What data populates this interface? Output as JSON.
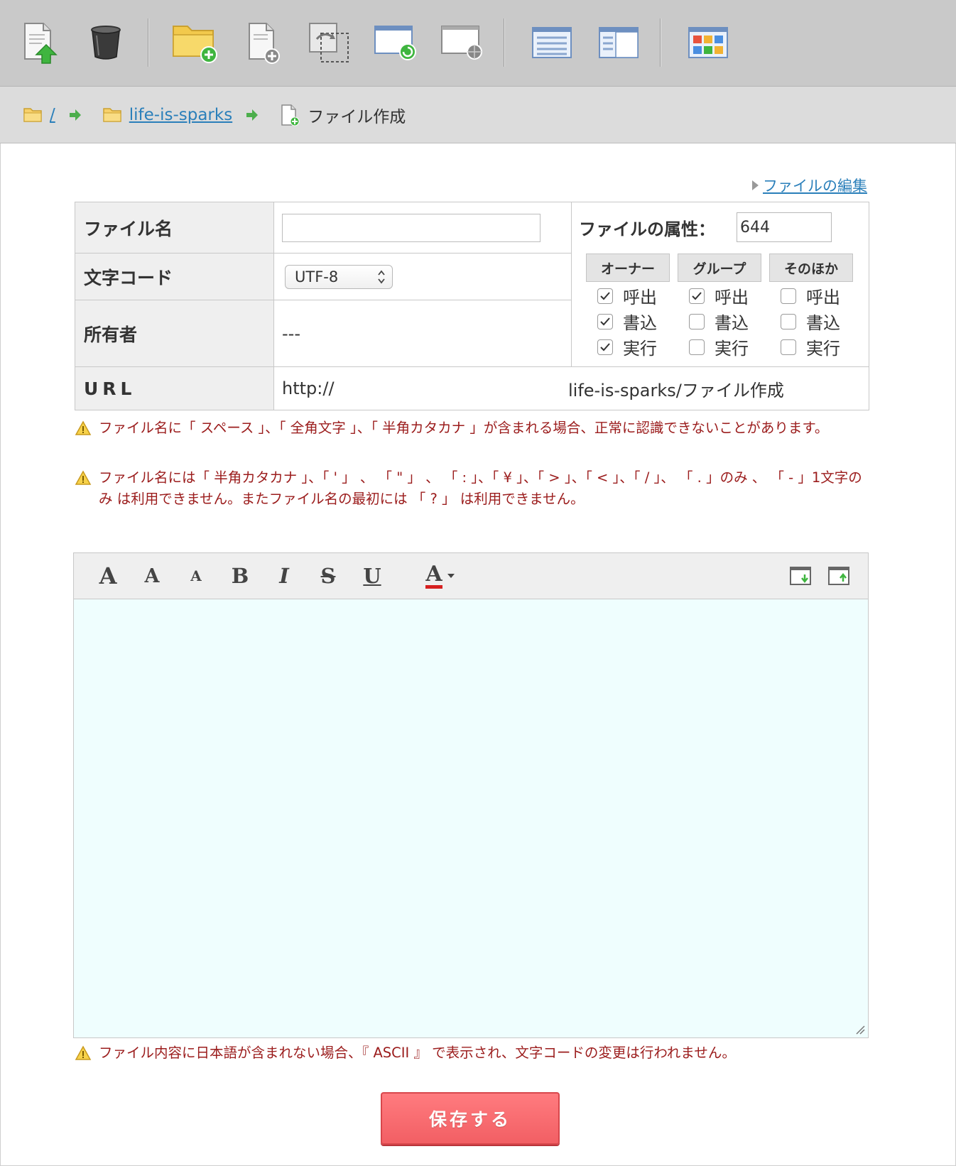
{
  "toolbar": {
    "buttons": [
      {
        "name": "upload-icon"
      },
      {
        "name": "trash-icon"
      },
      {
        "name": "new-folder-icon"
      },
      {
        "name": "new-file-icon"
      },
      {
        "name": "copy-icon"
      },
      {
        "name": "refresh-window-icon"
      },
      {
        "name": "web-window-icon"
      },
      {
        "name": "list-view-icon"
      },
      {
        "name": "split-view-icon"
      },
      {
        "name": "tile-view-icon"
      }
    ]
  },
  "breadcrumb": {
    "root": "/",
    "folder": "life-is-sparks",
    "current": "ファイル作成"
  },
  "edit_link": "ファイルの編集",
  "form": {
    "filename_label": "ファイル名",
    "filename_value": "",
    "charset_label": "文字コード",
    "charset_value": "UTF-8",
    "owner_label": "所有者",
    "owner_value": "---",
    "url_label": "URL",
    "url_value": "http://",
    "url_path": "life-is-sparks/ファイル作成",
    "attr_label": "ファイルの属性：",
    "attr_value": "644"
  },
  "permissions": {
    "headers": [
      "オーナー",
      "グループ",
      "そのほか"
    ],
    "rows": [
      "呼出",
      "書込",
      "実行"
    ],
    "checked": [
      [
        true,
        true,
        false
      ],
      [
        true,
        false,
        false
      ],
      [
        true,
        false,
        false
      ]
    ]
  },
  "warnings": {
    "w1": "ファイル名に「 スペース 」、「 全角文字 」、「 半角カタカナ 」が含まれる場合、正常に認識できないことがあります。",
    "w2": "ファイル名には「 半角カタカナ 」、「 ' 」 、 「 \" 」 、 「 : 」、「 ¥ 」、「 > 」、「 < 」、「 / 」、 「 . 」のみ 、 「 - 」1文字のみ は利用できません。またファイル名の最初には 「 ? 」 は利用できません。",
    "w3": "ファイル内容に日本語が含まれない場合、『 ASCII 』 で表示され、文字コードの変更は行われません。"
  },
  "editor": {
    "content": "",
    "buttons": {
      "large": "A",
      "medium": "A",
      "small": "A",
      "bold": "B",
      "italic": "I",
      "strike": "S",
      "underline": "U",
      "color": "A"
    }
  },
  "save_label": "保存する",
  "colors": {
    "link": "#2a7fba",
    "warning_text": "#9b1c1c",
    "save_button": "#f25f64",
    "editor_bg": "#effefe"
  }
}
